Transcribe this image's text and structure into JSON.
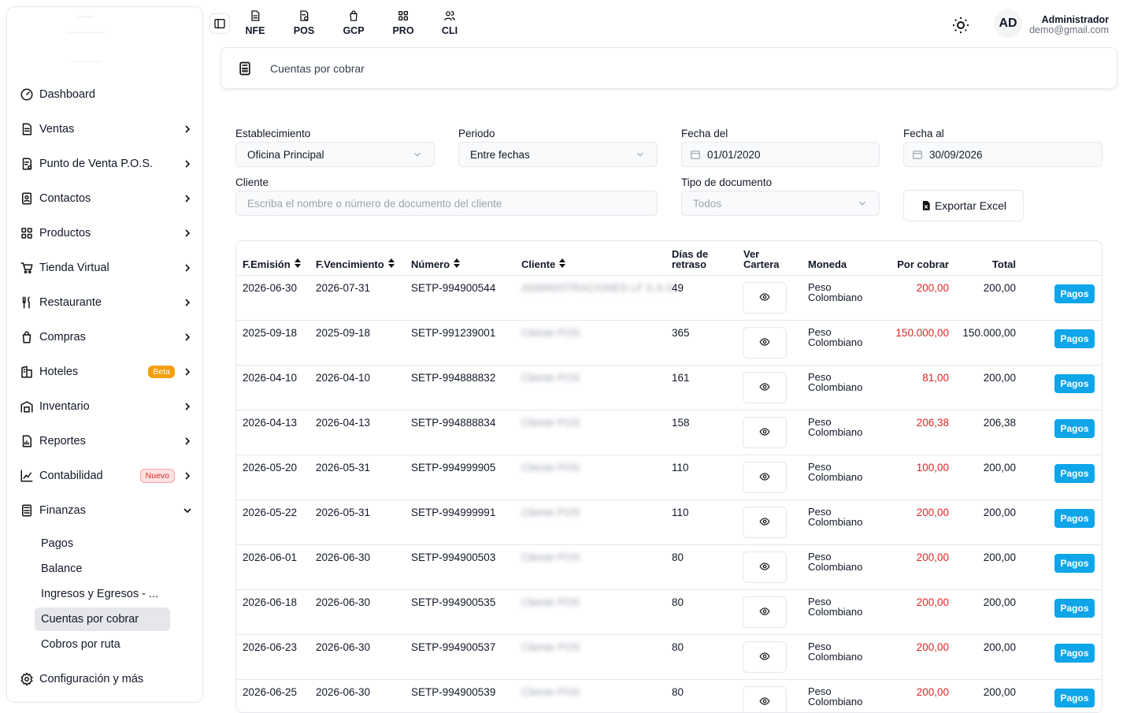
{
  "top_modules": [
    {
      "label": "NFE",
      "icon": "nfe-doc-icon"
    },
    {
      "label": "POS",
      "icon": "pos-invoice-icon"
    },
    {
      "label": "GCP",
      "icon": "gcp-bag-icon"
    },
    {
      "label": "PRO",
      "icon": "pro-grid-icon"
    },
    {
      "label": "CLI",
      "icon": "cli-users-icon"
    }
  ],
  "user": {
    "initials": "AD",
    "name": "Administrador",
    "email": "demo@gmail.com"
  },
  "sidebar": {
    "items": [
      {
        "label": "Dashboard",
        "icon": "gauge-icon"
      },
      {
        "label": "Ventas",
        "icon": "document-icon"
      },
      {
        "label": "Punto de Venta P.O.S.",
        "icon": "receipt-icon"
      },
      {
        "label": "Contactos",
        "icon": "contacts-icon"
      },
      {
        "label": "Productos",
        "icon": "grid-icon"
      },
      {
        "label": "Tienda Virtual",
        "icon": "cart-icon"
      },
      {
        "label": "Restaurante",
        "icon": "utensils-icon"
      },
      {
        "label": "Compras",
        "icon": "shopping-bag-icon"
      },
      {
        "label": "Hoteles",
        "icon": "hotel-icon",
        "badge": "Beta"
      },
      {
        "label": "Inventario",
        "icon": "warehouse-icon"
      },
      {
        "label": "Reportes",
        "icon": "report-icon"
      },
      {
        "label": "Contabilidad",
        "icon": "chart-icon",
        "badge": "Nuevo"
      },
      {
        "label": "Finanzas",
        "icon": "calculator-icon"
      }
    ],
    "finanzas_sub": [
      "Pagos",
      "Balance",
      "Ingresos y Egresos - ...",
      "Cuentas por cobrar",
      "Cobros por ruta"
    ],
    "config": "Configuración y más"
  },
  "breadcrumb": "Cuentas por cobrar",
  "filters": {
    "establecimiento_label": "Establecimiento",
    "establecimiento_value": "Oficina Principal",
    "periodo_label": "Periodo",
    "periodo_value": "Entre fechas",
    "fecha_del_label": "Fecha del",
    "fecha_del_value": "01/01/2020",
    "fecha_al_label": "Fecha al",
    "fecha_al_value": "30/09/2026",
    "cliente_label": "Cliente",
    "cliente_placeholder": "Escriba el nombre o número de documento del cliente",
    "tipo_label": "Tipo de documento",
    "tipo_value": "Todos",
    "export_label": "Exportar Excel"
  },
  "table": {
    "headers": [
      "F.Emisión",
      "F.Vencimiento",
      "Número",
      "Cliente",
      "Días de retraso",
      "Ver Cartera",
      "Moneda",
      "Por cobrar",
      "Total"
    ],
    "pagos_label": "Pagos",
    "rows": [
      {
        "emision": "2026-06-30",
        "vencimiento": "2026-07-31",
        "numero": "SETP-994900544",
        "cliente": "ADMINISTRACIONES LF S.A.S",
        "dias": "49",
        "moneda": "Peso Colombiano",
        "por_cobrar": "200,00",
        "total": "200,00"
      },
      {
        "emision": "2025-09-18",
        "vencimiento": "2025-09-18",
        "numero": "SETP-991239001",
        "cliente": "Cliente POS",
        "dias": "365",
        "moneda": "Peso Colombiano",
        "por_cobrar": "150.000,00",
        "total": "150.000,00"
      },
      {
        "emision": "2026-04-10",
        "vencimiento": "2026-04-10",
        "numero": "SETP-994888832",
        "cliente": "Cliente POS",
        "dias": "161",
        "moneda": "Peso Colombiano",
        "por_cobrar": "81,00",
        "total": "200,00"
      },
      {
        "emision": "2026-04-13",
        "vencimiento": "2026-04-13",
        "numero": "SETP-994888834",
        "cliente": "Cliente POS",
        "dias": "158",
        "moneda": "Peso Colombiano",
        "por_cobrar": "206,38",
        "total": "206,38"
      },
      {
        "emision": "2026-05-20",
        "vencimiento": "2026-05-31",
        "numero": "SETP-994999905",
        "cliente": "Cliente POS",
        "dias": "110",
        "moneda": "Peso Colombiano",
        "por_cobrar": "100,00",
        "total": "200,00"
      },
      {
        "emision": "2026-05-22",
        "vencimiento": "2026-05-31",
        "numero": "SETP-994999991",
        "cliente": "Cliente POS",
        "dias": "110",
        "moneda": "Peso Colombiano",
        "por_cobrar": "200,00",
        "total": "200,00"
      },
      {
        "emision": "2026-06-01",
        "vencimiento": "2026-06-30",
        "numero": "SETP-994900503",
        "cliente": "Cliente POS",
        "dias": "80",
        "moneda": "Peso Colombiano",
        "por_cobrar": "200,00",
        "total": "200,00"
      },
      {
        "emision": "2026-06-18",
        "vencimiento": "2026-06-30",
        "numero": "SETP-994900535",
        "cliente": "Cliente POS",
        "dias": "80",
        "moneda": "Peso Colombiano",
        "por_cobrar": "200,00",
        "total": "200,00"
      },
      {
        "emision": "2026-06-23",
        "vencimiento": "2026-06-30",
        "numero": "SETP-994900537",
        "cliente": "Cliente POS",
        "dias": "80",
        "moneda": "Peso Colombiano",
        "por_cobrar": "200,00",
        "total": "200,00"
      },
      {
        "emision": "2026-06-25",
        "vencimiento": "2026-06-30",
        "numero": "SETP-994900539",
        "cliente": "Cliente POS",
        "dias": "80",
        "moneda": "Peso Colombiano",
        "por_cobrar": "200,00",
        "total": "200,00"
      }
    ]
  }
}
